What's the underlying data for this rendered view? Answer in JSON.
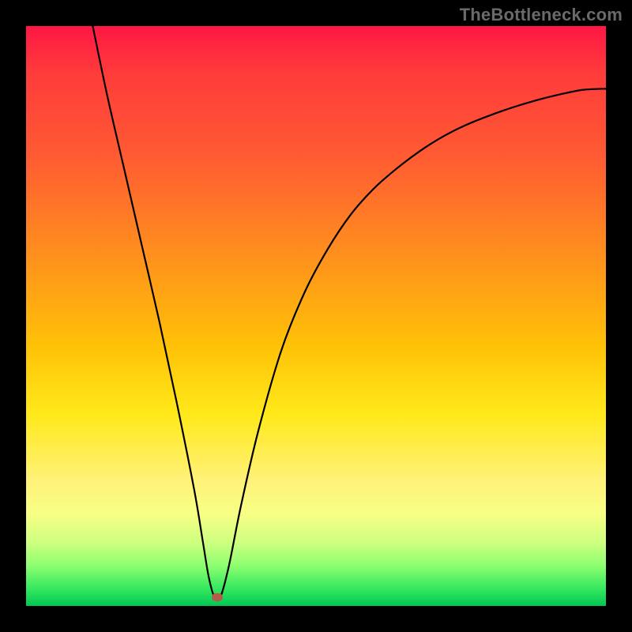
{
  "watermark": "TheBottleneck.com",
  "colors": {
    "frame_border": "#000000",
    "curve": "#000000",
    "marker": "#b85a4a",
    "gradient_top": "#ff1744",
    "gradient_bottom": "#00c853"
  },
  "chart_data": {
    "type": "line",
    "title": "",
    "xlabel": "",
    "ylabel": "",
    "xlim": [
      0,
      100
    ],
    "ylim": [
      0,
      100
    ],
    "grid": false,
    "legend_position": "none",
    "marker_point": {
      "x": 33,
      "y": 1.5
    },
    "series": [
      {
        "name": "curve",
        "x": [
          11.5,
          14,
          17,
          20,
          23,
          26,
          29,
          30.5,
          31.5,
          32.5,
          33.5,
          35,
          37,
          40,
          44,
          48,
          52,
          56,
          60,
          64,
          68,
          72,
          76,
          80,
          84,
          88,
          92,
          96,
          100
        ],
        "y": [
          100,
          88,
          75,
          62,
          49,
          35,
          20,
          11,
          5,
          1.5,
          1.5,
          7,
          17,
          30,
          44,
          54,
          61.5,
          67.5,
          72,
          75.5,
          78.5,
          81,
          83,
          84.6,
          86,
          87.2,
          88.2,
          89,
          89.2
        ]
      }
    ],
    "annotations": []
  }
}
